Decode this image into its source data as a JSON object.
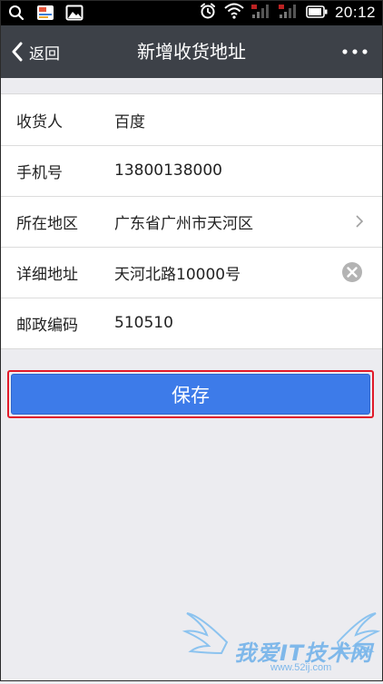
{
  "status_bar": {
    "time": "20:12"
  },
  "nav": {
    "back_label": "返回",
    "title": "新增收货地址"
  },
  "form": {
    "rows": [
      {
        "label": "收货人",
        "value": "百度"
      },
      {
        "label": "手机号",
        "value": "13800138000"
      },
      {
        "label": "所在地区",
        "value": "广东省广州市天河区"
      },
      {
        "label": "详细地址",
        "value": "天河北路10000号"
      },
      {
        "label": "邮政编码",
        "value": "510510"
      }
    ]
  },
  "save_label": "保存",
  "watermark": {
    "title": "我爱IT技术网",
    "url": "www.52ij.com"
  },
  "colors": {
    "nav_bg": "#3d4148",
    "save_bg": "#3d7be9",
    "highlight_border": "#e11a2a",
    "page_bg": "#ececf0"
  }
}
